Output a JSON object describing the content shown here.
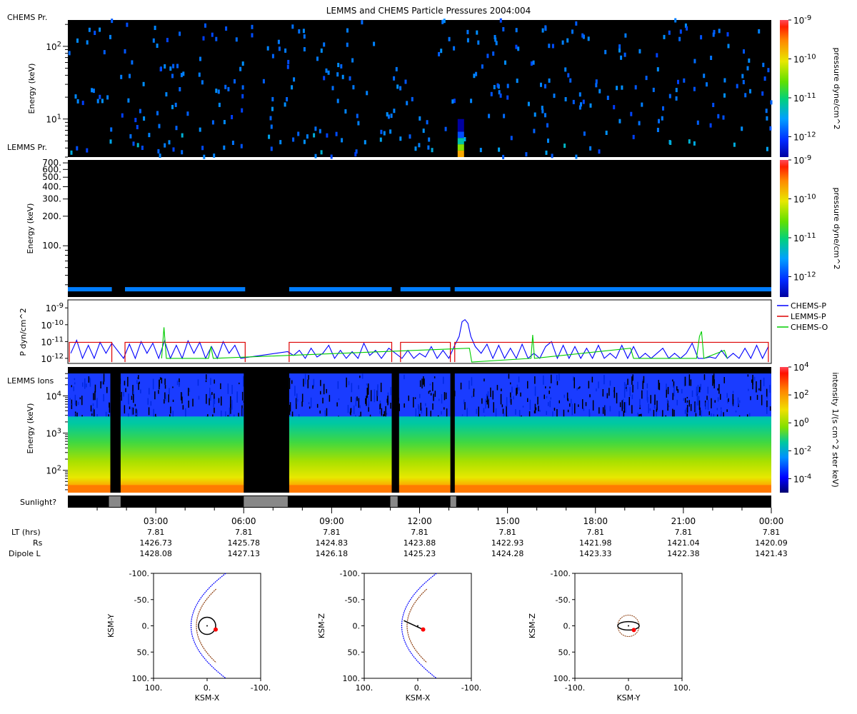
{
  "title": "LEMMS and CHEMS Particle Pressures  2004:004",
  "labels": {
    "chems_pr": "CHEMS Pr.",
    "lemms_pr": "LEMMS Pr.",
    "lemms_ions": "LEMMS Ions",
    "sunlight": "Sunlight?",
    "lt_label": "LT (hrs)",
    "rs_label": "Rs",
    "dipole_label": "Dipole L"
  },
  "colors": {
    "chems_p": "#0000ff",
    "lemms_p": "#dd0000",
    "chems_o": "#00cc00",
    "panel_bg": "#000000",
    "magnetopause": "#0000ff",
    "bowshock": "#8b3a0a",
    "spacecraft": "#ff0000"
  },
  "chart_data": [
    {
      "type": "heatmap",
      "panel": "CHEMS pressure spectrogram",
      "ylabel": "Energy (keV)",
      "yscale": "log",
      "ylim": [
        3,
        230
      ],
      "yticks": [
        {
          "v": 10,
          "base": "10",
          "exp": "1"
        },
        {
          "v": 100,
          "base": "10",
          "exp": "2"
        }
      ],
      "colorbar": {
        "label": "pressure dyne/cm^2",
        "scale": "log",
        "range": [
          3e-13,
          1e-09
        ],
        "ticks": [
          {
            "exp": "-9",
            "v": 1e-09
          },
          {
            "exp": "-10",
            "v": 1e-10
          },
          {
            "exp": "-11",
            "v": 1e-11
          },
          {
            "exp": "-12",
            "v": 1e-12
          }
        ]
      },
      "enhancement": {
        "t": 13.42,
        "energy_range": [
          3,
          10
        ],
        "peak": 2e-10
      }
    },
    {
      "type": "heatmap",
      "panel": "LEMMS pressure spectrogram",
      "ylabel": "Energy (keV)",
      "yscale": "log",
      "ylim": [
        30,
        750
      ],
      "yticks": [
        {
          "v": 100,
          "label": "100."
        },
        {
          "v": 200,
          "label": "200."
        },
        {
          "v": 300,
          "label": "300."
        },
        {
          "v": 400,
          "label": "400."
        },
        {
          "v": 500,
          "label": "500."
        },
        {
          "v": 600,
          "label": "600."
        },
        {
          "v": 700,
          "label": "700."
        }
      ],
      "band_energy": 36,
      "band_value": 2e-12,
      "segments": [
        [
          0,
          1.5
        ],
        [
          1.95,
          6.05
        ],
        [
          7.55,
          11.05
        ],
        [
          11.35,
          13.05
        ],
        [
          13.2,
          24
        ]
      ],
      "colorbar": {
        "label": "pressure dyne/cm^2",
        "scale": "log",
        "range": [
          3e-13,
          1e-09
        ],
        "ticks": [
          {
            "exp": "-9",
            "v": 1e-09
          },
          {
            "exp": "-10",
            "v": 1e-10
          },
          {
            "exp": "-11",
            "v": 1e-11
          },
          {
            "exp": "-12",
            "v": 1e-12
          }
        ]
      }
    },
    {
      "type": "line",
      "panel": "pressure time series",
      "ylabel": "P dyn/cm^2",
      "yscale": "log",
      "ylim": [
        5e-13,
        3e-09
      ],
      "yticks": [
        {
          "exp": "-9",
          "v": 1e-09
        },
        {
          "exp": "-10",
          "v": 1e-10
        },
        {
          "exp": "-11",
          "v": 1e-11
        },
        {
          "exp": "-12",
          "v": 1e-12
        }
      ],
      "xlim": [
        0,
        24
      ],
      "series": [
        {
          "name": "CHEMS-P",
          "color": "#0000ff",
          "points": [
            [
              0.1,
              2e-12
            ],
            [
              0.3,
              1.2e-11
            ],
            [
              0.5,
              1e-12
            ],
            [
              0.7,
              6e-12
            ],
            [
              0.9,
              1e-12
            ],
            [
              1.1,
              9e-12
            ],
            [
              1.3,
              2e-12
            ],
            [
              1.5,
              8e-12
            ],
            [
              1.9,
              1e-12
            ],
            [
              2.1,
              7e-12
            ],
            [
              2.3,
              1e-12
            ],
            [
              2.5,
              1e-11
            ],
            [
              2.7,
              2e-12
            ],
            [
              2.9,
              8e-12
            ],
            [
              3.1,
              1e-12
            ],
            [
              3.3,
              1.1e-11
            ],
            [
              3.5,
              1e-12
            ],
            [
              3.7,
              6e-12
            ],
            [
              3.9,
              1e-12
            ],
            [
              4.1,
              1.1e-11
            ],
            [
              4.3,
              2e-12
            ],
            [
              4.5,
              9e-12
            ],
            [
              4.7,
              1e-12
            ],
            [
              4.9,
              5e-12
            ],
            [
              5.1,
              1e-12
            ],
            [
              5.3,
              1e-11
            ],
            [
              5.5,
              2e-12
            ],
            [
              5.7,
              6e-12
            ],
            [
              5.9,
              1e-12
            ],
            [
              6.05,
              1.1e-12
            ],
            [
              7.5,
              2.5e-12
            ],
            [
              7.7,
              1.5e-12
            ],
            [
              7.9,
              3e-12
            ],
            [
              8.1,
              1e-12
            ],
            [
              8.3,
              4e-12
            ],
            [
              8.5,
              1.2e-12
            ],
            [
              8.7,
              2e-12
            ],
            [
              8.9,
              6e-12
            ],
            [
              9.1,
              1e-12
            ],
            [
              9.3,
              3e-12
            ],
            [
              9.5,
              1e-12
            ],
            [
              9.7,
              2.5e-12
            ],
            [
              9.9,
              1e-12
            ],
            [
              10.1,
              8e-12
            ],
            [
              10.3,
              1.5e-12
            ],
            [
              10.5,
              3e-12
            ],
            [
              10.7,
              1e-12
            ],
            [
              10.95,
              4e-12
            ],
            [
              11.4,
              1e-12
            ],
            [
              11.6,
              3e-12
            ],
            [
              11.8,
              1e-12
            ],
            [
              12.0,
              2e-12
            ],
            [
              12.2,
              1.2e-12
            ],
            [
              12.4,
              5e-12
            ],
            [
              12.6,
              1e-12
            ],
            [
              12.8,
              3e-12
            ],
            [
              13.0,
              1e-12
            ],
            [
              13.2,
              6e-12
            ],
            [
              13.35,
              2e-11
            ],
            [
              13.45,
              1.5e-10
            ],
            [
              13.55,
              2e-10
            ],
            [
              13.65,
              1.2e-10
            ],
            [
              13.75,
              2e-11
            ],
            [
              13.9,
              5e-12
            ],
            [
              14.1,
              2e-12
            ],
            [
              14.3,
              7e-12
            ],
            [
              14.5,
              1e-12
            ],
            [
              14.7,
              6e-12
            ],
            [
              14.9,
              1e-12
            ],
            [
              15.1,
              4e-12
            ],
            [
              15.3,
              1e-12
            ],
            [
              15.5,
              7e-12
            ],
            [
              15.7,
              1e-12
            ],
            [
              15.9,
              2e-12
            ],
            [
              16.1,
              1e-12
            ],
            [
              16.3,
              5e-12
            ],
            [
              16.5,
              1e-11
            ],
            [
              16.7,
              1e-12
            ],
            [
              16.9,
              6e-12
            ],
            [
              17.1,
              1e-12
            ],
            [
              17.3,
              5e-12
            ],
            [
              17.5,
              1e-12
            ],
            [
              17.7,
              4e-12
            ],
            [
              17.9,
              1e-12
            ],
            [
              18.1,
              6e-12
            ],
            [
              18.3,
              1e-12
            ],
            [
              18.5,
              2e-12
            ],
            [
              18.7,
              1e-12
            ],
            [
              18.9,
              6e-12
            ],
            [
              19.1,
              1e-12
            ],
            [
              19.3,
              5e-12
            ],
            [
              19.5,
              1e-12
            ],
            [
              19.7,
              2e-12
            ],
            [
              19.9,
              1e-12
            ],
            [
              20.1,
              2e-12
            ],
            [
              20.3,
              4e-12
            ],
            [
              20.5,
              1e-12
            ],
            [
              20.7,
              2e-12
            ],
            [
              20.9,
              1e-12
            ],
            [
              21.1,
              2e-12
            ],
            [
              21.3,
              8e-12
            ],
            [
              21.5,
              1e-12
            ],
            [
              21.7,
              1e-12
            ],
            [
              21.9,
              1.2e-12
            ],
            [
              22.1,
              1e-12
            ],
            [
              22.3,
              3e-12
            ],
            [
              22.5,
              1e-12
            ],
            [
              22.7,
              2e-12
            ],
            [
              22.9,
              1e-12
            ],
            [
              23.1,
              4e-12
            ],
            [
              23.3,
              1e-12
            ],
            [
              23.5,
              6e-12
            ],
            [
              23.7,
              1e-12
            ],
            [
              23.9,
              5e-12
            ]
          ]
        },
        {
          "name": "LEMMS-P",
          "color": "#dd0000",
          "segments": [
            [
              0.05,
              1.5,
              9e-12
            ],
            [
              1.95,
              6.05,
              9e-12
            ],
            [
              7.55,
              11.05,
              9e-12
            ],
            [
              11.35,
              13.05,
              9e-12
            ],
            [
              13.2,
              23.9,
              9e-12
            ]
          ]
        },
        {
          "name": "CHEMS-O",
          "color": "#00cc00",
          "points": [
            [
              3.2,
              1e-12
            ],
            [
              3.28,
              7e-11
            ],
            [
              3.36,
              1e-12
            ],
            [
              4.8,
              1e-12
            ],
            [
              4.88,
              5e-12
            ],
            [
              4.96,
              1e-12
            ],
            [
              13.7,
              4e-12
            ],
            [
              13.78,
              6e-13
            ],
            [
              15.8,
              1e-12
            ],
            [
              15.86,
              2.5e-11
            ],
            [
              15.92,
              1e-12
            ],
            [
              19.2,
              4e-12
            ],
            [
              19.3,
              1e-12
            ],
            [
              21.45,
              1e-12
            ],
            [
              21.55,
              2e-11
            ],
            [
              21.62,
              4e-11
            ],
            [
              21.7,
              1e-12
            ],
            [
              22.4,
              3e-12
            ],
            [
              22.5,
              1e-12
            ]
          ]
        }
      ]
    },
    {
      "type": "heatmap",
      "panel": "LEMMS ion intensity spectrogram",
      "ylabel": "Energy (keV)",
      "yscale": "log",
      "ylim": [
        25,
        60000
      ],
      "yticks": [
        {
          "v": 100,
          "base": "10",
          "exp": "2"
        },
        {
          "v": 1000,
          "base": "10",
          "exp": "3"
        },
        {
          "v": 10000,
          "base": "10",
          "exp": "4"
        }
      ],
      "gaps": [
        [
          1.45,
          1.8
        ],
        [
          6.0,
          7.55
        ],
        [
          11.05,
          11.3
        ],
        [
          13.05,
          13.2
        ]
      ],
      "colorbar": {
        "label": "intensity 1/(s cm^2 ster keV)",
        "scale": "log",
        "range": [
          1e-05,
          10000.0
        ],
        "ticks": [
          {
            "exp": "4",
            "v": 10000.0
          },
          {
            "exp": "2",
            "v": 100
          },
          {
            "exp": "0",
            "v": 1
          },
          {
            "exp": "-2",
            "v": 0.01
          },
          {
            "exp": "-4",
            "v": 0.0001
          }
        ]
      }
    },
    {
      "type": "bar",
      "panel": "sunlight indicator",
      "sunlit_intervals": [
        [
          1.4,
          1.8
        ],
        [
          6.0,
          7.5
        ],
        [
          11.0,
          11.25
        ],
        [
          13.05,
          13.25
        ]
      ]
    }
  ],
  "time_axis": {
    "xlim": [
      0,
      24
    ],
    "ticks": [
      {
        "t": 3,
        "label": "03:00",
        "lt": "7.81",
        "rs": "1426.73",
        "dipole": "1428.08"
      },
      {
        "t": 6,
        "label": "06:00",
        "lt": "7.81",
        "rs": "1425.78",
        "dipole": "1427.13"
      },
      {
        "t": 9,
        "label": "09:00",
        "lt": "7.81",
        "rs": "1424.83",
        "dipole": "1426.18"
      },
      {
        "t": 12,
        "label": "12:00",
        "lt": "7.81",
        "rs": "1423.88",
        "dipole": "1425.23"
      },
      {
        "t": 15,
        "label": "15:00",
        "lt": "7.81",
        "rs": "1422.93",
        "dipole": "1424.28"
      },
      {
        "t": 18,
        "label": "18:00",
        "lt": "7.81",
        "rs": "1421.98",
        "dipole": "1423.33"
      },
      {
        "t": 21,
        "label": "21:00",
        "lt": "7.81",
        "rs": "1421.04",
        "dipole": "1422.38"
      },
      {
        "t": 24,
        "label": "00:00",
        "lt": "7.81",
        "rs": "1420.09",
        "dipole": "1421.43"
      }
    ]
  },
  "orbit_plots": [
    {
      "xlabel": "KSM-X",
      "ylabel": "KSM-Y",
      "x_tick_labels": [
        "100.",
        "0.",
        "-100."
      ],
      "y_tick_labels": [
        "-100.",
        "-50.",
        "0.",
        "50.",
        "100."
      ],
      "trajectory": "circle",
      "traj_center": [
        0,
        0
      ],
      "traj_radius": 16,
      "spacecraft": [
        -16,
        7
      ]
    },
    {
      "xlabel": "KSM-X",
      "ylabel": "KSM-Z",
      "x_tick_labels": [
        "100.",
        "0.",
        "-100."
      ],
      "y_tick_labels": [
        "-100.",
        "-50.",
        "0.",
        "50.",
        "100."
      ],
      "trajectory": "line",
      "traj_start": [
        26,
        -10
      ],
      "traj_end": [
        -10,
        7
      ],
      "spacecraft": [
        -10,
        7
      ]
    },
    {
      "xlabel": "KSM-Y",
      "ylabel": "KSM-Z",
      "x_tick_labels": [
        "-100.",
        "0.",
        "100."
      ],
      "y_tick_labels": [
        "-100.",
        "-50.",
        "0.",
        "50.",
        "100."
      ],
      "trajectory": "ellipse",
      "traj_center": [
        0,
        0
      ],
      "traj_rx": 20,
      "traj_ry": 8,
      "spacecraft": [
        10,
        8
      ]
    }
  ]
}
